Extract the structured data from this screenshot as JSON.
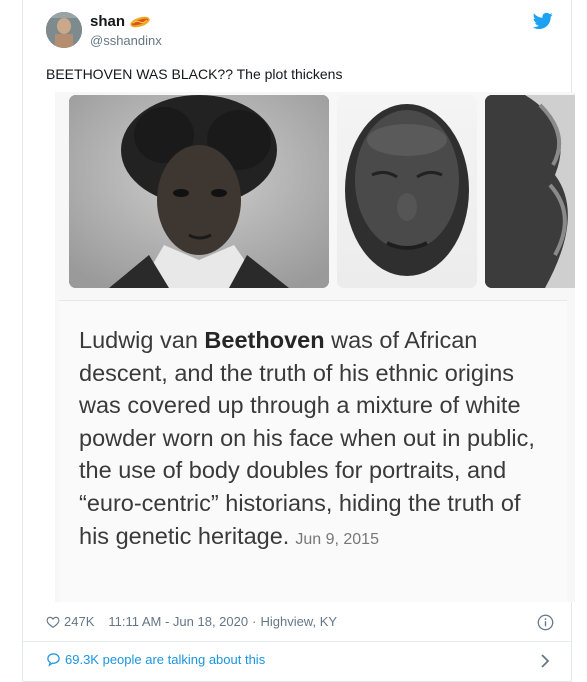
{
  "author": {
    "name": "shan",
    "handle": "@sshandinx",
    "badge_icon": "hotdog-emoji-icon"
  },
  "tweet": {
    "text": "BEETHOVEN WAS BLACK?? The plot thickens"
  },
  "quote": {
    "pre": "Ludwig van ",
    "bold": "Beethoven",
    "post": " was of African descent, and the truth of his ethnic origins was covered up through a mixture of white powder worn on his face when out in public, the use of body doubles for portraits, and “euro-centric” historians, hiding the truth of his genetic heritage.",
    "date": "Jun 9, 2015"
  },
  "meta": {
    "likes": "247K",
    "timestamp": "11:11 AM - Jun 18, 2020",
    "separator": "·",
    "location": "Highview, KY"
  },
  "footer": {
    "talk_text": "69.3K people are talking about this"
  },
  "colors": {
    "twitter_blue": "#1da1f2",
    "link_blue": "#1b95e0",
    "gray_text": "#657786"
  }
}
